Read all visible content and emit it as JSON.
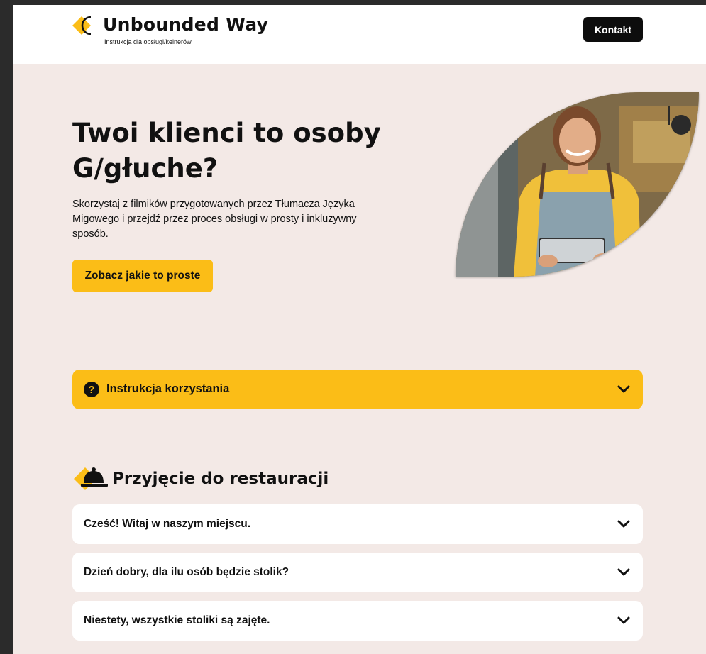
{
  "header": {
    "brand_name": "Unbounded Way",
    "brand_subtitle": "Instrukcja dla obsługi/kelnerów",
    "contact_label": "Kontakt"
  },
  "hero": {
    "title": "Twoi klienci to osoby G/głuche?",
    "text": "Skorzystaj z filmików przygotowanych przez Tłumacza Języka Migowego i przejdź przez proces obsługi w prosty i inkluzywny sposób.",
    "cta_label": "Zobacz jakie to proste"
  },
  "instructions": {
    "icon": "question-circle-icon",
    "icon_glyph": "?",
    "label": "Instrukcja korzystania"
  },
  "section": {
    "icon": "service-bell-icon",
    "title": "Przyjęcie do restauracji",
    "items": [
      {
        "label": "Cześć! Witaj w naszym miejscu."
      },
      {
        "label": "Dzień dobry, dla ilu osób będzie stolik?"
      },
      {
        "label": "Niestety, wszystkie stoliki są zajęte."
      }
    ]
  },
  "colors": {
    "accent": "#fbbd17",
    "background": "#f3e9e6",
    "dark": "#0d0d0d"
  }
}
